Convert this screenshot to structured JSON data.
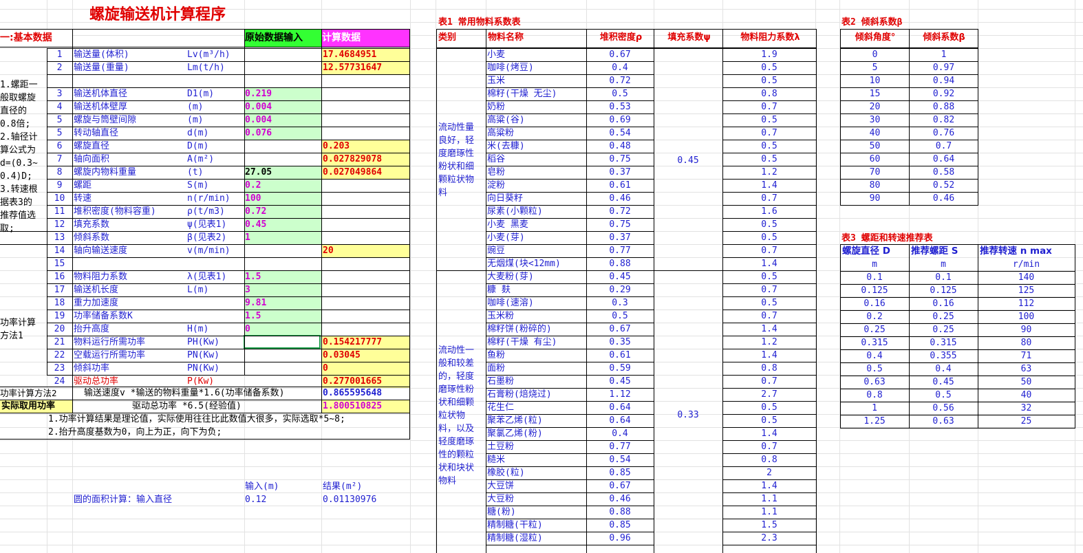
{
  "title": "螺旋输送机计算程序",
  "section": {
    "label": "一:基本数据",
    "input_header": "原始数据输入",
    "calc_header": "计算数据"
  },
  "side_note1": [
    "1.螺距一",
    "般取螺旋",
    "直径的",
    "0.8倍;",
    "2.轴径计",
    "算公式为",
    "d=(0.3~",
    "0.4)D;",
    "3.转速根",
    "据表3的",
    "推荐值选",
    "取;"
  ],
  "side_note2": [
    "功率计算",
    "方法1"
  ],
  "rows": [
    {
      "n": "1",
      "label": "输送量(体积)",
      "sym": "Lv(m³/h)",
      "input": "",
      "result": "17.4684951"
    },
    {
      "n": "2",
      "label": "输送量(重量)",
      "sym": "Lm(t/h)",
      "input": "",
      "result": "12.57731647"
    },
    {
      "n": "3",
      "label": "输送机体直径",
      "sym": "D1(m)",
      "input": "0.219",
      "result": ""
    },
    {
      "n": "4",
      "label": "输送机体壁厚",
      "sym": "(m)",
      "input": "0.004",
      "result": ""
    },
    {
      "n": "5",
      "label": "螺旋与筒壁间隙",
      "sym": "(m)",
      "input": "0.004",
      "result": ""
    },
    {
      "n": "5",
      "label": "转动轴直径",
      "sym": "d(m)",
      "input": "0.076",
      "result": ""
    },
    {
      "n": "6",
      "label": "螺旋直径",
      "sym": "D(m)",
      "input": "",
      "result": "0.203"
    },
    {
      "n": "7",
      "label": "轴向面积",
      "sym": "A(m²)",
      "input": "",
      "result": "0.027829078"
    },
    {
      "n": "8",
      "label": "螺旋内物料重量",
      "sym": "(t)",
      "input": "27.05",
      "result": "0.027049864"
    },
    {
      "n": "9",
      "label": "螺距",
      "sym": "S(m)",
      "input": "0.2",
      "result": ""
    },
    {
      "n": "10",
      "label": "转速",
      "sym": "n(r/min)",
      "input": "100",
      "result": ""
    },
    {
      "n": "11",
      "label": "堆积密度(物料容重)",
      "sym": "ρ(t/m3)",
      "input": "0.72",
      "result": ""
    },
    {
      "n": "12",
      "label": "填充系数",
      "sym": "ψ(见表1)",
      "input": "0.45",
      "result": ""
    },
    {
      "n": "13",
      "label": "倾斜系数",
      "sym": "β(见表2)",
      "input": "1",
      "result": ""
    },
    {
      "n": "14",
      "label": "轴向输送速度",
      "sym": "v(m/min)",
      "input": "",
      "result": "20"
    },
    {
      "n": "15",
      "label": "",
      "sym": "",
      "input": "",
      "result": ""
    },
    {
      "n": "16",
      "label": "物料阻力系数",
      "sym": "λ(见表1)",
      "input": "1.5",
      "result": ""
    },
    {
      "n": "17",
      "label": "输送机长度",
      "sym": "L(m)",
      "input": "3",
      "result": ""
    },
    {
      "n": "18",
      "label": "重力加速度",
      "sym": "",
      "input": "9.81",
      "result": ""
    },
    {
      "n": "19",
      "label": "功率储备系数K",
      "sym": "",
      "input": "1.5",
      "result": ""
    },
    {
      "n": "20",
      "label": "抬升高度",
      "sym": "H(m)",
      "input": "0",
      "result": ""
    },
    {
      "n": "21",
      "label": "物料运行所需功率",
      "sym": "PH(Kw)",
      "input": "",
      "result": "0.154217777"
    },
    {
      "n": "22",
      "label": "空载运行所需功率",
      "sym": "PN(Kw)",
      "input": "",
      "result": "0.03045"
    },
    {
      "n": "23",
      "label": "倾斜功率",
      "sym": "PN(Kw)",
      "input": "",
      "result": "0"
    },
    {
      "n": "24",
      "label": "驱动总功率",
      "sym": "P(Kw)",
      "input": "",
      "result": "0.277001665"
    }
  ],
  "method2": {
    "label": "功率计算方法2",
    "formula": "输送速度v *输送的物料重量*1.6(功率储备系数)",
    "result": "0.865595648"
  },
  "actual": {
    "label": "实际取用功率",
    "formula": "驱动总功率 *6.5(经验值)",
    "result": "1.800510825"
  },
  "notes": [
    "1.功率计算结果是理论值，实际使用往往比此数值大很多，实际选取*5~8;",
    "2.抬升高度基数为0，向上为正，向下为负;"
  ],
  "circle": {
    "input_hdr": "输入(m)",
    "result_hdr": "结果(m²)",
    "label": "圆的面积计算：输入直径",
    "input": "0.12",
    "result": "0.01130976"
  },
  "table1": {
    "title": "表1 常用物料系数表",
    "headers": [
      "类别",
      "物料名称",
      "堆积密度ρ",
      "填充系数ψ",
      "物料阻力系数λ"
    ],
    "group1": {
      "desc": [
        "流动性量",
        "良好，轻",
        "度磨琢性",
        "粉状和细",
        "颗粒状物",
        "料"
      ],
      "fill": "0.45"
    },
    "group2": {
      "desc": [
        "流动性一",
        "般和较差",
        "的，轻度",
        "磨琢性粉",
        "状和细颗",
        "粒状物",
        "料，以及",
        "轻度磨琢",
        "性的颗粒",
        "状和块状",
        "物料"
      ],
      "fill": "0.33"
    },
    "rows": [
      [
        "小麦",
        "0.67",
        "1.9"
      ],
      [
        "咖啡(烤豆)",
        "0.4",
        "0.5"
      ],
      [
        "玉米",
        "0.72",
        "0.5"
      ],
      [
        "棉籽(干燥 无尘)",
        "0.5",
        "0.8"
      ],
      [
        "奶粉",
        "0.53",
        "0.7"
      ],
      [
        "高粱(谷)",
        "0.69",
        "0.5"
      ],
      [
        "高粱粉",
        "0.54",
        "0.7"
      ],
      [
        "米(去糠)",
        "0.48",
        "0.5"
      ],
      [
        "稻谷",
        "0.75",
        "0.5"
      ],
      [
        "皂粉",
        "0.37",
        "1.2"
      ],
      [
        "淀粉",
        "0.61",
        "1.4"
      ],
      [
        "向日葵籽",
        "0.46",
        "0.7"
      ],
      [
        "尿素(小颗粒)",
        "0.72",
        "1.6"
      ],
      [
        "小麦 黑麦",
        "0.75",
        "0.5"
      ],
      [
        "小麦(芽)",
        "0.37",
        "0.5"
      ],
      [
        "豌豆",
        "0.77",
        "0.7"
      ],
      [
        "无烟煤(块<12mm)",
        "0.88",
        "1.4"
      ],
      [
        "大麦粉(芽)",
        "0.45",
        "0.5"
      ],
      [
        "糠 麸",
        "0.29",
        "0.7"
      ],
      [
        "咖啡(速溶)",
        "0.3",
        "0.5"
      ],
      [
        "玉米粉",
        "0.5",
        "0.7"
      ],
      [
        "棉籽饼(粉碎的)",
        "0.67",
        "1.4"
      ],
      [
        "棉籽(干燥 有尘)",
        "0.35",
        "1.2"
      ],
      [
        "鱼粉",
        "0.61",
        "1.4"
      ],
      [
        "面粉",
        "0.59",
        "0.8"
      ],
      [
        "石墨粉",
        "0.45",
        "0.7"
      ],
      [
        "石膏粉(焙烧过)",
        "1.12",
        "2.7"
      ],
      [
        "花生仁",
        "0.64",
        "0.5"
      ],
      [
        "聚苯乙烯(粒)",
        "0.64",
        "0.5"
      ],
      [
        "聚氯乙烯(粉)",
        "0.4",
        "1.4"
      ],
      [
        "土豆粉",
        "0.77",
        "0.7"
      ],
      [
        "糙米",
        "0.54",
        "0.8"
      ],
      [
        "橡胶(粒)",
        "0.85",
        "2"
      ],
      [
        "大豆饼",
        "0.67",
        "1.4"
      ],
      [
        "大豆粉",
        "0.46",
        "1.1"
      ],
      [
        "糖(粉)",
        "0.88",
        "1.1"
      ],
      [
        "精制糖(干粒)",
        "0.85",
        "1.5"
      ],
      [
        "精制糖(湿粒)",
        "0.96",
        "2.3"
      ]
    ]
  },
  "table2": {
    "title": "表2 倾斜系数β",
    "headers": [
      "倾斜角度°",
      "倾斜系数β"
    ],
    "rows": [
      [
        "0",
        "1"
      ],
      [
        "5",
        "0.97"
      ],
      [
        "10",
        "0.94"
      ],
      [
        "15",
        "0.92"
      ],
      [
        "20",
        "0.88"
      ],
      [
        "30",
        "0.82"
      ],
      [
        "40",
        "0.76"
      ],
      [
        "50",
        "0.7"
      ],
      [
        "60",
        "0.64"
      ],
      [
        "70",
        "0.58"
      ],
      [
        "80",
        "0.52"
      ],
      [
        "90",
        "0.46"
      ]
    ]
  },
  "table3": {
    "title": "表3 螺距和转速推荐表",
    "headers": [
      "螺旋直径 D",
      "推荐螺距 S",
      "推荐转速 n max"
    ],
    "units": [
      "m",
      "m",
      "r/min"
    ],
    "rows": [
      [
        "0.1",
        "0.1",
        "140"
      ],
      [
        "0.125",
        "0.125",
        "125"
      ],
      [
        "0.16",
        "0.16",
        "112"
      ],
      [
        "0.2",
        "0.25",
        "100"
      ],
      [
        "0.25",
        "0.25",
        "90"
      ],
      [
        "0.315",
        "0.315",
        "80"
      ],
      [
        "0.4",
        "0.355",
        "71"
      ],
      [
        "0.5",
        "0.4",
        "63"
      ],
      [
        "0.63",
        "0.45",
        "50"
      ],
      [
        "0.8",
        "0.5",
        "40"
      ],
      [
        "1",
        "0.56",
        "32"
      ],
      [
        "1.25",
        "0.63",
        "25"
      ]
    ]
  }
}
